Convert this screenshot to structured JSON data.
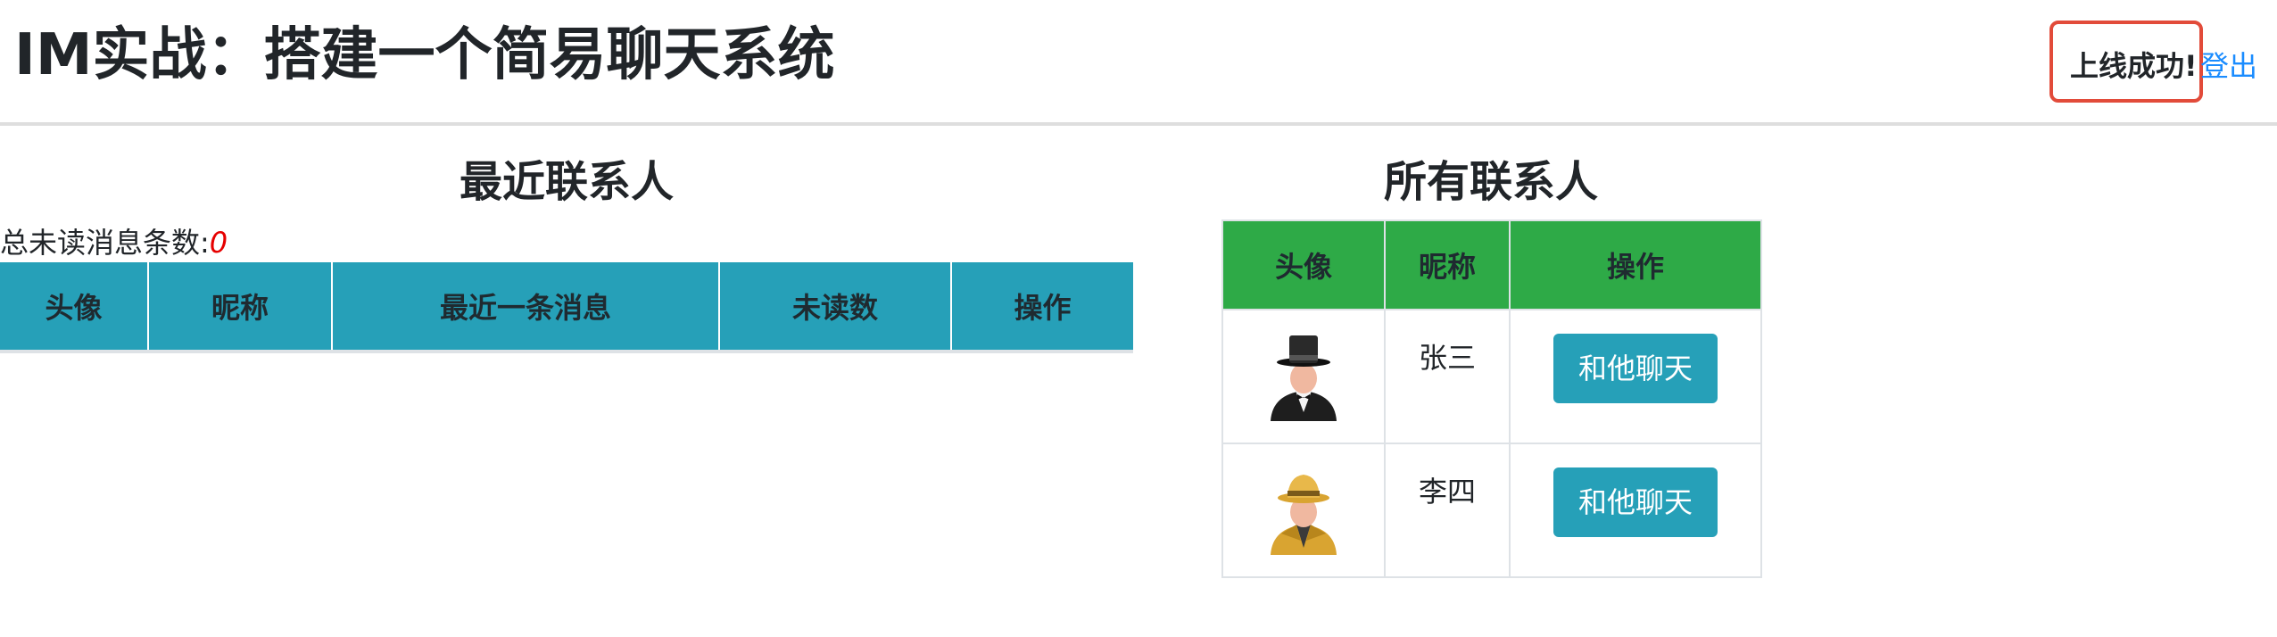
{
  "header": {
    "title": "IM实战：搭建一个简易聊天系统",
    "status_text": "上线成功!",
    "logout_label": "登出"
  },
  "recent": {
    "heading": "最近联系人",
    "unread_label": "总未读消息条数:",
    "unread_count": "0",
    "columns": [
      "头像",
      "昵称",
      "最近一条消息",
      "未读数",
      "操作"
    ]
  },
  "all": {
    "heading": "所有联系人",
    "columns": [
      "头像",
      "昵称",
      "操作"
    ],
    "rows": [
      {
        "avatar_icon": "man-top-hat-icon",
        "nickname": "张三",
        "action_label": "和他聊天"
      },
      {
        "avatar_icon": "man-fedora-icon",
        "nickname": "李四",
        "action_label": "和他聊天"
      }
    ]
  },
  "colors": {
    "recent_header_bg": "#26a0b8",
    "all_header_bg": "#2eaa47",
    "button_bg": "#26a0b8",
    "status_border": "#e24b3a",
    "link": "#1a8cff",
    "unread_count": "#e60000"
  }
}
